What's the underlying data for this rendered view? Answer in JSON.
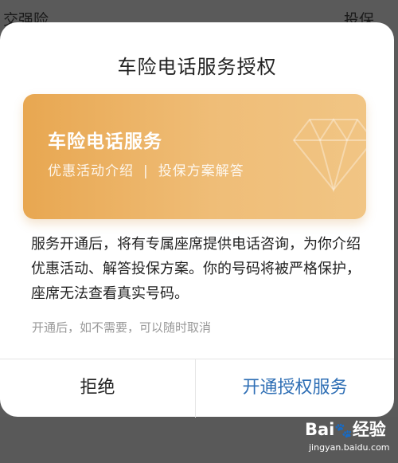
{
  "background": {
    "left_text": "交强险",
    "right_text": "投保"
  },
  "dialog": {
    "title": "车险电话服务授权",
    "card": {
      "title": "车险电话服务",
      "subtitle_left": "优惠活动介绍",
      "separator": "|",
      "subtitle_right": "投保方案解答",
      "icon": "diamond-icon"
    },
    "description": "服务开通后，将有专属座席提供电话咨询，为你介绍优惠活动、解答投保方案。你的号码将被严格保护，座席无法查看真实号码。",
    "note": "开通后，如不需要，可以随时取消",
    "buttons": {
      "reject": "拒绝",
      "accept": "开通授权服务"
    }
  },
  "colors": {
    "card_gradient_start": "#e8a751",
    "card_gradient_end": "#f1c584",
    "accept_text": "#2f6fb5",
    "overlay": "#5a5a5a"
  },
  "watermark": {
    "brand": "Bai",
    "brand_suffix": "经验",
    "url": "jingyan.baidu.com"
  }
}
